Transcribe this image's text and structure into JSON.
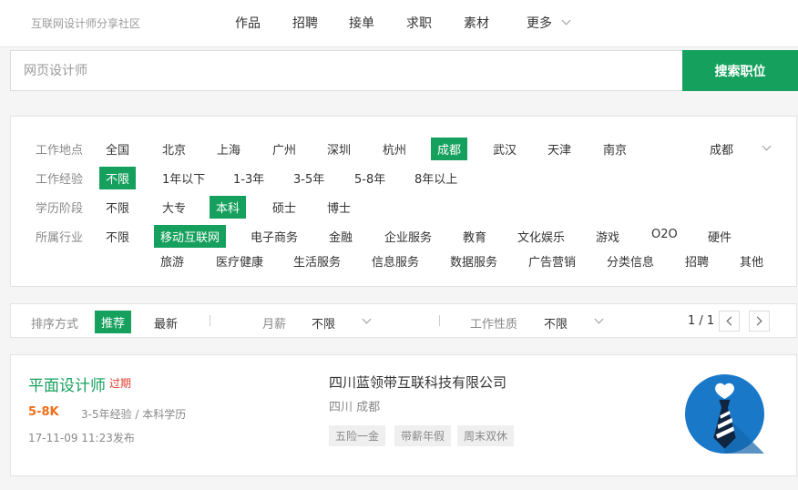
{
  "header": {
    "brand": "互联网设计师分享社区",
    "nav": [
      "作品",
      "招聘",
      "接单",
      "求职",
      "素材",
      "更多"
    ]
  },
  "search": {
    "placeholder": "网页设计师",
    "button": "搜索职位"
  },
  "filters": {
    "location": {
      "label": "工作地点",
      "options": [
        "全国",
        "北京",
        "上海",
        "广州",
        "深圳",
        "杭州",
        "成都",
        "武汉",
        "天津",
        "南京"
      ],
      "selected": "成都",
      "dropdown_value": "成都"
    },
    "experience": {
      "label": "工作经验",
      "options": [
        "不限",
        "1年以下",
        "1-3年",
        "3-5年",
        "5-8年",
        "8年以上"
      ],
      "selected": "不限"
    },
    "education": {
      "label": "学历阶段",
      "options": [
        "不限",
        "大专",
        "本科",
        "硕士",
        "博士"
      ],
      "selected": "本科"
    },
    "industry": {
      "label": "所属行业",
      "options": [
        "不限",
        "移动互联网",
        "电子商务",
        "金融",
        "企业服务",
        "教育",
        "文化娱乐",
        "游戏",
        "O2O",
        "硬件",
        "旅游",
        "医疗健康",
        "生活服务",
        "信息服务",
        "数据服务",
        "广告营销",
        "分类信息",
        "招聘",
        "其他"
      ],
      "selected": "移动互联网"
    }
  },
  "sort": {
    "label": "排序方式",
    "options": [
      "推荐",
      "最新"
    ],
    "selected": "推荐",
    "salary_label": "月薪",
    "salary_value": "不限",
    "nature_label": "工作性质",
    "nature_value": "不限",
    "page": "1 / 1"
  },
  "jobs": [
    {
      "title": "平面设计师",
      "status": "过期",
      "salary": "5-8K",
      "requirements": "3-5年经验 / 本科学历",
      "published": "17-11-09 11:23发布",
      "company": "四川蓝领带互联科技有限公司",
      "location": "四川 成都",
      "tags": [
        "五险一金",
        "带薪年假",
        "周末双休"
      ],
      "logo_icon": "necktie-logo-icon"
    }
  ],
  "colors": {
    "accent": "#16a05d",
    "salary": "#f26d1a",
    "expired": "#e23b2e",
    "logo_blue": "#1a78c9"
  }
}
